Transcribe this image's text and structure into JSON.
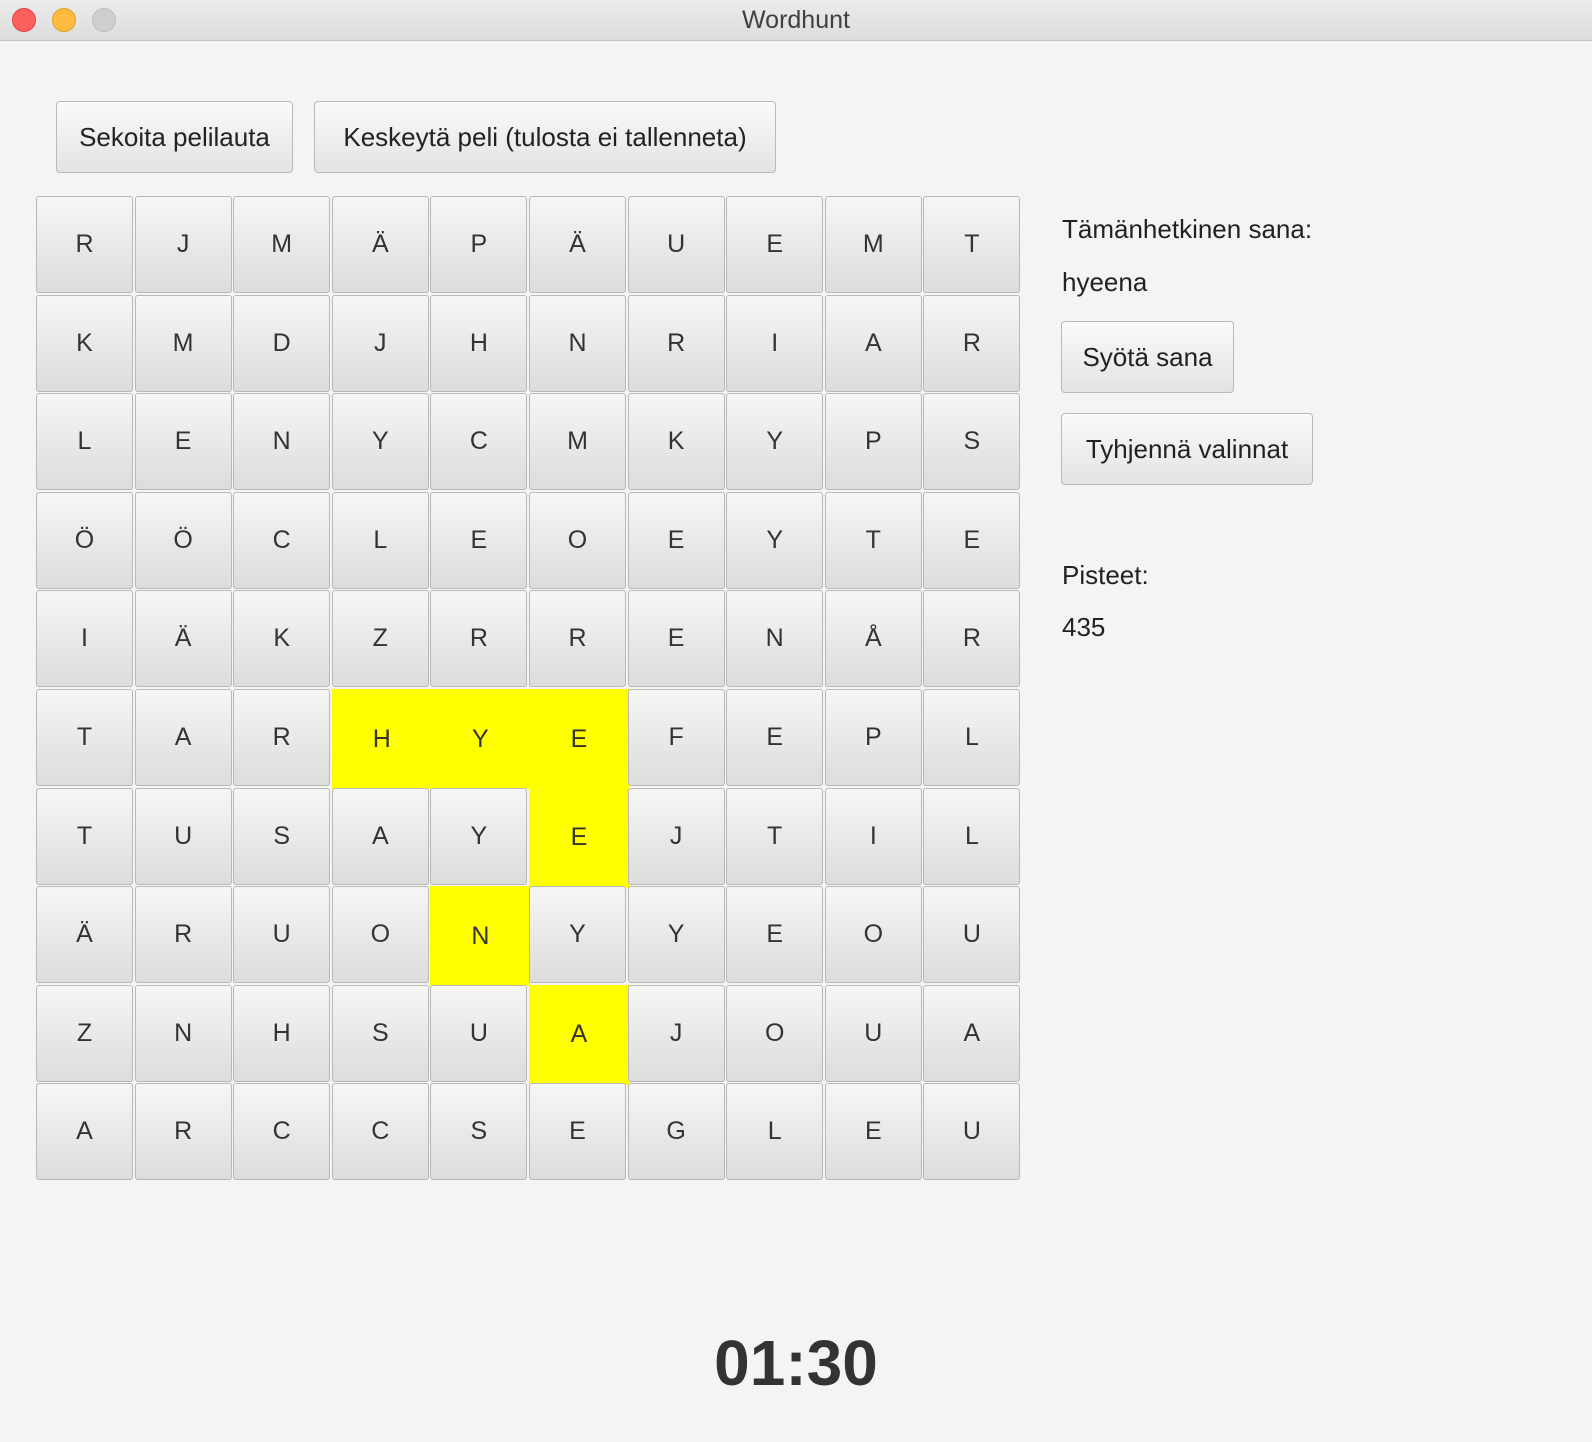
{
  "window": {
    "title": "Wordhunt"
  },
  "toolbar": {
    "shuffle_label": "Sekoita pelilauta",
    "quit_label": "Keskeytä peli (tulosta ei tallenneta)"
  },
  "board": {
    "rows": [
      [
        "R",
        "J",
        "M",
        "Ä",
        "P",
        "Ä",
        "U",
        "E",
        "M",
        "T"
      ],
      [
        "K",
        "M",
        "D",
        "J",
        "H",
        "N",
        "R",
        "I",
        "A",
        "R"
      ],
      [
        "L",
        "E",
        "N",
        "Y",
        "C",
        "M",
        "K",
        "Y",
        "P",
        "S"
      ],
      [
        "Ö",
        "Ö",
        "C",
        "L",
        "E",
        "O",
        "E",
        "Y",
        "T",
        "E"
      ],
      [
        "I",
        "Ä",
        "K",
        "Z",
        "R",
        "R",
        "E",
        "N",
        "Å",
        "R"
      ],
      [
        "T",
        "A",
        "R",
        "H",
        "Y",
        "E",
        "F",
        "E",
        "P",
        "L"
      ],
      [
        "T",
        "U",
        "S",
        "A",
        "Y",
        "E",
        "J",
        "T",
        "I",
        "L"
      ],
      [
        "Ä",
        "R",
        "U",
        "O",
        "N",
        "Y",
        "Y",
        "E",
        "O",
        "U"
      ],
      [
        "Z",
        "N",
        "H",
        "S",
        "U",
        "A",
        "J",
        "O",
        "U",
        "A"
      ],
      [
        "A",
        "R",
        "C",
        "C",
        "S",
        "E",
        "G",
        "L",
        "E",
        "U"
      ]
    ],
    "selected_cells": [
      [
        5,
        3
      ],
      [
        5,
        4
      ],
      [
        5,
        5
      ],
      [
        6,
        5
      ],
      [
        7,
        4
      ],
      [
        8,
        5
      ]
    ],
    "highlight_color": "#ffff00"
  },
  "side": {
    "current_word_label": "Tämänhetkinen sana:",
    "current_word": "hyeena",
    "submit_label": "Syötä sana",
    "clear_label": "Tyhjennä valinnat",
    "score_label": "Pisteet:",
    "score": "435"
  },
  "timer": {
    "value": "01:30"
  }
}
